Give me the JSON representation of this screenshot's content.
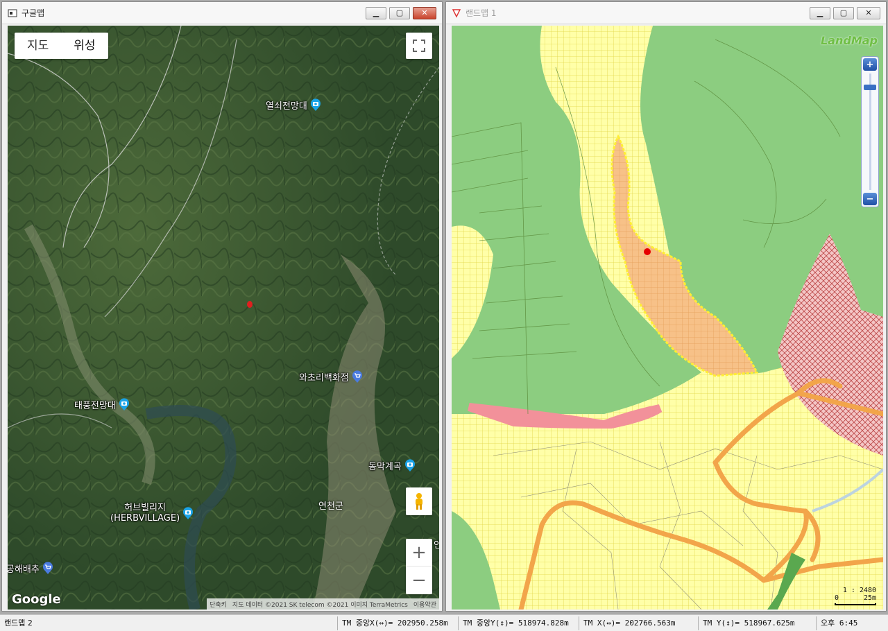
{
  "left_window": {
    "title": "구글맵",
    "map_type": {
      "map": "지도",
      "satellite": "위성"
    },
    "pois": [
      {
        "label": "열쇠전망대",
        "icon": "camera-icon"
      },
      {
        "label": "와초리백화점",
        "icon": "shopping-cart-icon"
      },
      {
        "label": "태풍전망대",
        "icon": "camera-icon"
      },
      {
        "label": "동막계곡",
        "icon": "camera-icon"
      },
      {
        "label": "허브빌리지\n(HERBVILLAGE)",
        "icon": "camera-icon"
      },
      {
        "label": "공해배추",
        "icon": "shopping-cart-icon"
      }
    ],
    "towns": [
      "연천군",
      "인"
    ],
    "google_logo": "Google",
    "attribution": {
      "shortcuts": "단축키",
      "data": "지도 데이터 ©2021 SK telecom ©2021 이미지 TerraMetrics",
      "terms": "이용약관"
    },
    "zoom_in": "+",
    "zoom_out": "−"
  },
  "right_window": {
    "title": "랜드맵 1",
    "logo": "LandMap",
    "scale": {
      "ratio": "1 : 2480",
      "zero": "0",
      "distance": "25m"
    },
    "colors": {
      "forest": "#8ccd80",
      "farmland": "#ffff9e",
      "parcel": "#f7c188",
      "road": "#f2a54a",
      "red_zone": "#f2919a"
    }
  },
  "status": {
    "app": "랜드맵 2",
    "tm_center_x": "TM 중앙X(↔)= 202950.258m",
    "tm_center_y": "TM 중앙Y(↕)= 518974.828m",
    "tm_x": "TM X(↔)= 202766.563m",
    "tm_y": "TM Y(↕)= 518967.625m",
    "time": "오후 6:45"
  }
}
